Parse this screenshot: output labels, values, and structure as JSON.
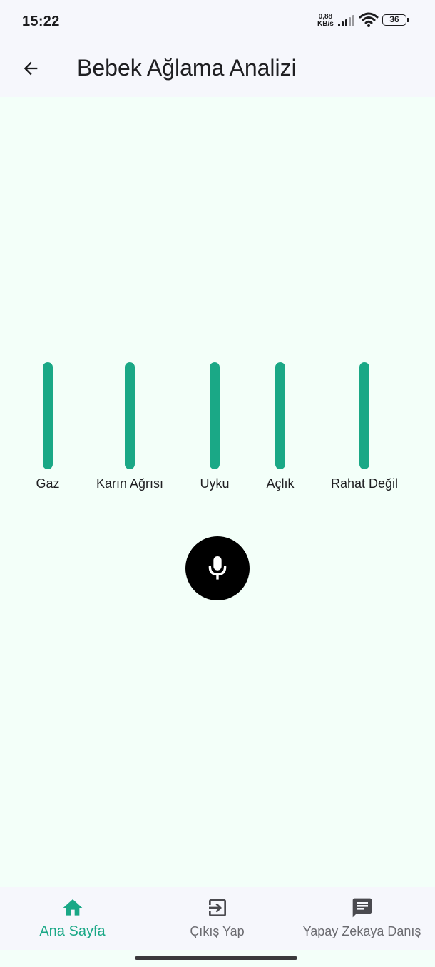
{
  "status_bar": {
    "time": "15:22",
    "net_speed_value": "0,88",
    "net_speed_unit": "KB/s",
    "battery": "36",
    "icons": [
      "signal-icon",
      "wifi-icon",
      "battery-icon"
    ]
  },
  "app_bar": {
    "title": "Bebek Ağlama Analizi",
    "back_icon": "arrow-left-icon"
  },
  "analysis": {
    "bars": [
      {
        "label": "Gaz",
        "level": 1.0
      },
      {
        "label": "Karın Ağrısı",
        "level": 1.0
      },
      {
        "label": "Uyku",
        "level": 1.0
      },
      {
        "label": "Açlık",
        "level": 1.0
      },
      {
        "label": "Rahat Değil",
        "level": 1.0
      }
    ],
    "bar_color": "#1aa886",
    "mic_icon": "microphone-icon"
  },
  "bottom_nav": {
    "items": [
      {
        "label": "Ana Sayfa",
        "icon": "home-icon",
        "active": true
      },
      {
        "label": "Çıkış Yap",
        "icon": "logout-icon",
        "active": false
      },
      {
        "label": "Yapay Zekaya Danış",
        "icon": "chat-icon",
        "active": false
      }
    ],
    "active_color": "#1aa886",
    "inactive_color": "#6b6b70"
  }
}
